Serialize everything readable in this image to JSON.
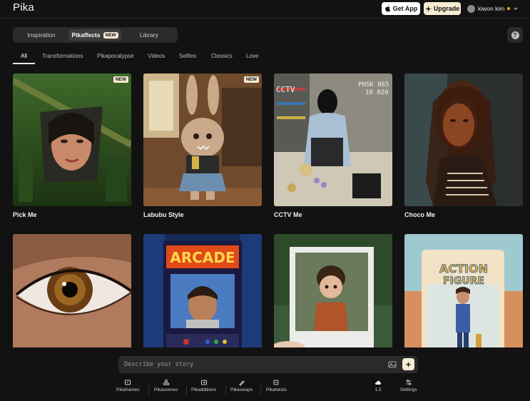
{
  "header": {
    "logo": "Pika",
    "get_app": "Get App",
    "upgrade": "Upgrade",
    "user_name": "kiwon kim"
  },
  "seg": {
    "items": [
      "Inspiration",
      "Pikaffects",
      "Library"
    ],
    "new_badge": "NEW",
    "help": "?"
  },
  "categories": [
    "All",
    "Transformations",
    "Pikapocalypse",
    "Videos",
    "Selfies",
    "Classics",
    "Love"
  ],
  "cards": [
    {
      "title": "Pick Me",
      "badge": "NEW"
    },
    {
      "title": "Labubu Style",
      "badge": "NEW"
    },
    {
      "title": "CCTV Me",
      "cctv_text": "PHSK 865\n10 020"
    },
    {
      "title": "Choco Me"
    },
    {
      "title": ""
    },
    {
      "title": "",
      "arcade_text": "ARCADE"
    },
    {
      "title": ""
    },
    {
      "title": "",
      "action_text": "ACTION FIGURE"
    }
  ],
  "prompt": {
    "placeholder": "Describe your story",
    "send": "+"
  },
  "tools": [
    "Pikaframes",
    "Pikascenes",
    "Pikadditions",
    "Pikaswaps",
    "Pikatwists"
  ],
  "credits": "1.5",
  "settings": "Settings",
  "colors": {
    "accent": "#f6ecd2",
    "bg": "#121212",
    "surface": "#2b2b2b"
  }
}
